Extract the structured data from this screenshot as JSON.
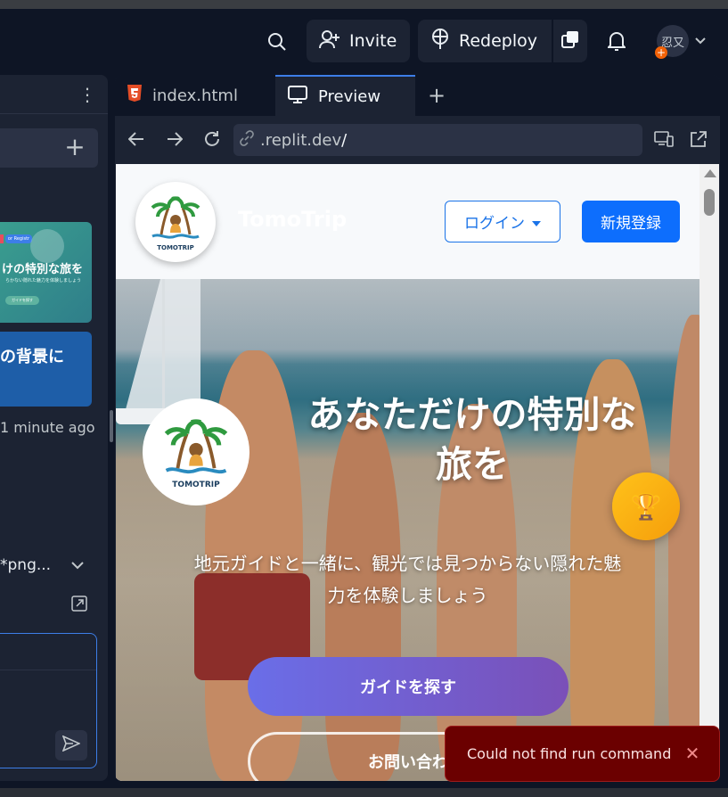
{
  "header": {
    "invite_label": "Invite",
    "redeploy_label": "Redeploy",
    "avatar_text": "忍又",
    "avatar_badge": "+"
  },
  "sidebar": {
    "thumb1_pill": "or Registr",
    "thumb1_title": "けの特別な旅を",
    "thumb1_sub": "らかない隠れた魅力を体験しましょう",
    "thumb1_button": "ガイドを探す",
    "thumb2_title": "の背景に",
    "time_ago": "1 minute ago",
    "file_label": "*png..."
  },
  "tabs": [
    {
      "label": "index.html",
      "icon": "html5-icon"
    },
    {
      "label": "Preview",
      "icon": "monitor-icon"
    }
  ],
  "url": {
    "host": ".replit.dev",
    "path": "/"
  },
  "site": {
    "brand": "TomoTrip",
    "logo_text": "TOMOTRIP",
    "login_label": "ログイン",
    "signup_label": "新規登録",
    "hero_title_line1": "あなただけの特別な",
    "hero_title_line2": "旅を",
    "hero_sub_line1": "地元ガイドと一緒に、観光では見つからない隠れた魅",
    "hero_sub_line2": "力を体験しましょう",
    "primary_cta": "ガイドを探す",
    "secondary_cta": "お問い合わ",
    "trophy_icon": "🏆"
  },
  "toast": {
    "message": "Could not find run command"
  },
  "colors": {
    "accent": "#3d7ee8",
    "primary": "#0d6efd",
    "error_bg": "#6b0000"
  }
}
